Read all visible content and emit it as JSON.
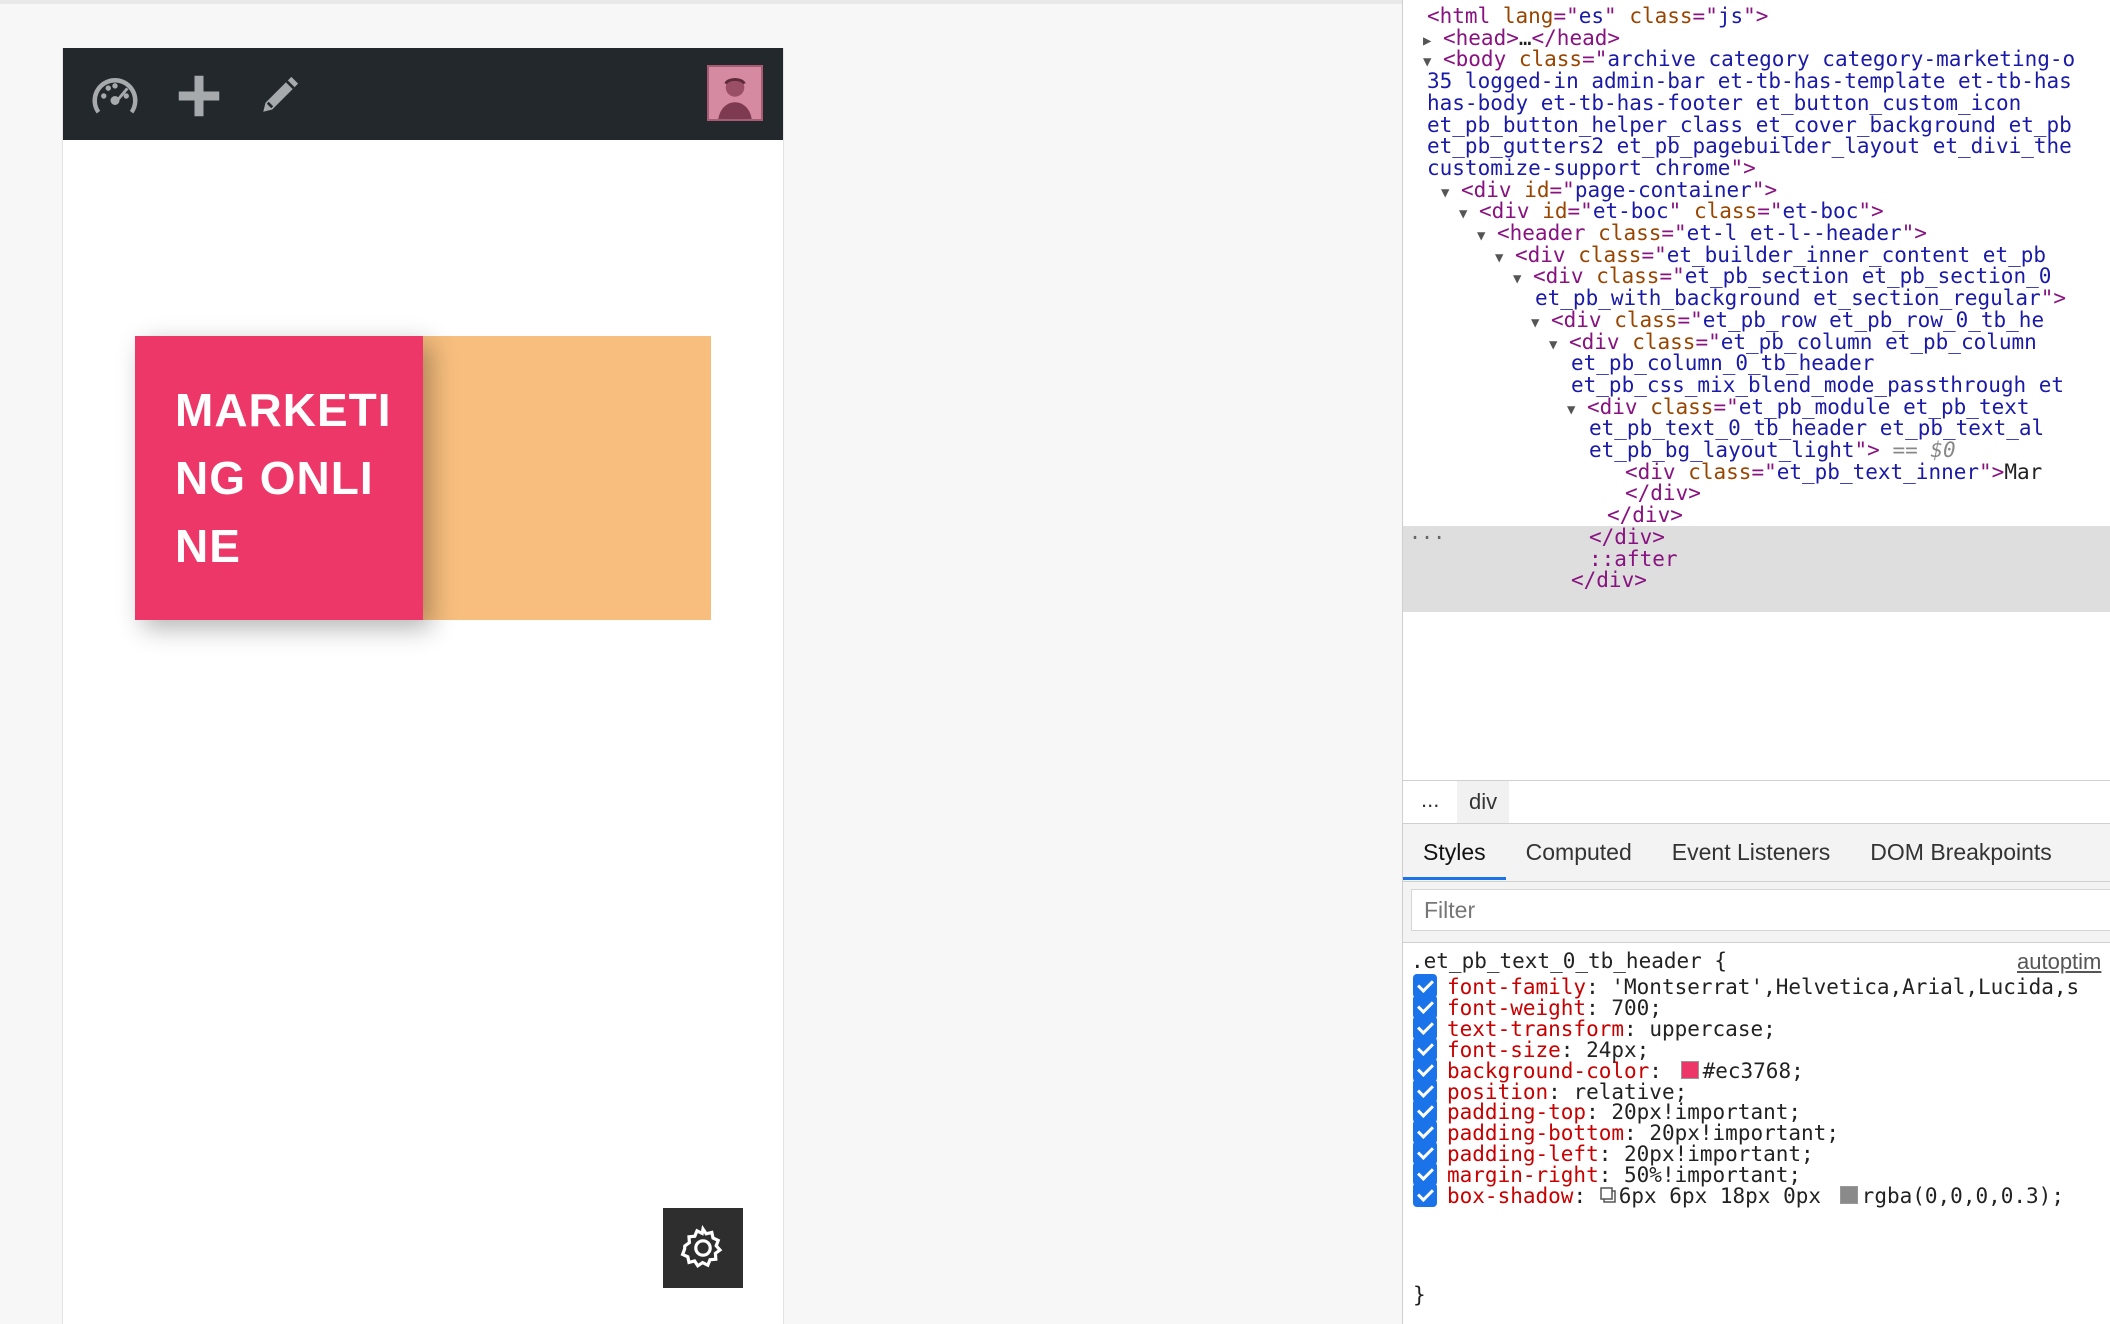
{
  "admin_bar": {
    "icons": [
      "dashboard-icon",
      "plus-icon",
      "pencil-icon"
    ],
    "avatar": "avatar"
  },
  "header": {
    "text": "Marketing Online",
    "pink_color": "#ec3768",
    "peach_color": "#f7be7e"
  },
  "elements": {
    "lines": [
      {
        "indent": 0,
        "tri": "",
        "parts": [
          [
            "tg",
            "<html "
          ],
          [
            "at",
            "lang"
          ],
          [
            "tg",
            "=\""
          ],
          [
            "av",
            "es"
          ],
          [
            "tg",
            "\" "
          ],
          [
            "at",
            "class"
          ],
          [
            "tg",
            "=\""
          ],
          [
            "av",
            "js"
          ],
          [
            "tg",
            "\">"
          ]
        ]
      },
      {
        "indent": 1,
        "tri": "▶",
        "parts": [
          [
            "tg",
            "<head>"
          ],
          [
            "tx",
            "…"
          ],
          [
            "tg",
            "</head>"
          ]
        ]
      },
      {
        "indent": 1,
        "tri": "▼",
        "parts": [
          [
            "tg",
            "<body "
          ],
          [
            "at",
            "class"
          ],
          [
            "tg",
            "=\""
          ],
          [
            "av",
            "archive category category-marketing-o"
          ]
        ]
      },
      {
        "indent": 0,
        "tri": "",
        "parts": [
          [
            "av",
            "35 logged-in admin-bar et-tb-has-template et-tb-has"
          ]
        ]
      },
      {
        "indent": 0,
        "tri": "",
        "parts": [
          [
            "av",
            "has-body et-tb-has-footer et_button_custom_icon"
          ]
        ]
      },
      {
        "indent": 0,
        "tri": "",
        "parts": [
          [
            "av",
            "et_pb_button_helper_class et_cover_background et_pb"
          ]
        ]
      },
      {
        "indent": 0,
        "tri": "",
        "parts": [
          [
            "av",
            "et_pb_gutters2 et_pb_pagebuilder_layout et_divi_the"
          ]
        ]
      },
      {
        "indent": 0,
        "tri": "",
        "parts": [
          [
            "av",
            "customize-support chrome"
          ],
          [
            "tg",
            "\">"
          ]
        ]
      },
      {
        "indent": 2,
        "tri": "▼",
        "parts": [
          [
            "tg",
            "<div "
          ],
          [
            "at",
            "id"
          ],
          [
            "tg",
            "=\""
          ],
          [
            "av",
            "page-container"
          ],
          [
            "tg",
            "\">"
          ]
        ]
      },
      {
        "indent": 3,
        "tri": "▼",
        "parts": [
          [
            "tg",
            "<div "
          ],
          [
            "at",
            "id"
          ],
          [
            "tg",
            "=\""
          ],
          [
            "av",
            "et-boc"
          ],
          [
            "tg",
            "\" "
          ],
          [
            "at",
            "class"
          ],
          [
            "tg",
            "=\""
          ],
          [
            "av",
            "et-boc"
          ],
          [
            "tg",
            "\">"
          ]
        ]
      },
      {
        "indent": 4,
        "tri": "▼",
        "parts": [
          [
            "tg",
            "<header "
          ],
          [
            "at",
            "class"
          ],
          [
            "tg",
            "=\""
          ],
          [
            "av",
            "et-l et-l--header"
          ],
          [
            "tg",
            "\">"
          ]
        ]
      },
      {
        "indent": 5,
        "tri": "▼",
        "parts": [
          [
            "tg",
            "<div "
          ],
          [
            "at",
            "class"
          ],
          [
            "tg",
            "=\""
          ],
          [
            "av",
            "et_builder_inner_content et_pb"
          ]
        ]
      },
      {
        "indent": 6,
        "tri": "▼",
        "parts": [
          [
            "tg",
            "<div "
          ],
          [
            "at",
            "class"
          ],
          [
            "tg",
            "=\""
          ],
          [
            "av",
            "et_pb_section et_pb_section_0"
          ]
        ]
      },
      {
        "indent": 6,
        "tri": "",
        "parts": [
          [
            "av",
            "et_pb_with_background et_section_regular"
          ],
          [
            "tg",
            "\">"
          ]
        ]
      },
      {
        "indent": 7,
        "tri": "▼",
        "parts": [
          [
            "tg",
            "<div "
          ],
          [
            "at",
            "class"
          ],
          [
            "tg",
            "=\""
          ],
          [
            "av",
            "et_pb_row et_pb_row_0_tb_he"
          ]
        ]
      },
      {
        "indent": 8,
        "tri": "▼",
        "parts": [
          [
            "tg",
            "<div "
          ],
          [
            "at",
            "class"
          ],
          [
            "tg",
            "=\""
          ],
          [
            "av",
            "et_pb_column et_pb_column"
          ]
        ]
      },
      {
        "indent": 8,
        "tri": "",
        "parts": [
          [
            "av",
            "et_pb_column_0_tb_header"
          ]
        ]
      },
      {
        "indent": 8,
        "tri": "",
        "parts": [
          [
            "av",
            "et_pb_css_mix_blend_mode_passthrough et"
          ]
        ]
      },
      {
        "indent": 9,
        "tri": "▼",
        "parts": [
          [
            "tg",
            "<div "
          ],
          [
            "at",
            "class"
          ],
          [
            "tg",
            "=\""
          ],
          [
            "av",
            "et_pb_module et_pb_text"
          ]
        ]
      },
      {
        "indent": 9,
        "tri": "",
        "parts": [
          [
            "av",
            "et_pb_text_0_tb_header  et_pb_text_al"
          ]
        ]
      },
      {
        "indent": 9,
        "tri": "",
        "parts": [
          [
            "av",
            "et_pb_bg_layout_light"
          ],
          [
            "tg",
            "\">"
          ],
          [
            "dim",
            " == $0"
          ]
        ]
      },
      {
        "indent": 11,
        "tri": "",
        "parts": [
          [
            "tg",
            "<div "
          ],
          [
            "at",
            "class"
          ],
          [
            "tg",
            "=\""
          ],
          [
            "av",
            "et_pb_text_inner"
          ],
          [
            "tg",
            "\">"
          ],
          [
            "tx",
            "Mar"
          ]
        ]
      },
      {
        "indent": 11,
        "tri": "",
        "parts": [
          [
            "tg",
            "</div>"
          ]
        ]
      },
      {
        "indent": 10,
        "tri": "",
        "parts": [
          [
            "tg",
            "</div>"
          ]
        ]
      },
      {
        "indent": 9,
        "tri": "",
        "parts": [
          [
            "tg",
            "</div>"
          ]
        ]
      },
      {
        "indent": 9,
        "tri": "",
        "parts": [
          [
            "tg",
            "::after"
          ]
        ]
      },
      {
        "indent": 8,
        "tri": "",
        "parts": [
          [
            "tg",
            "</div>"
          ]
        ]
      }
    ],
    "gutter": "..."
  },
  "breadcrumb": {
    "dots": "...",
    "current": "div"
  },
  "tabs": [
    "Styles",
    "Computed",
    "Event Listeners",
    "DOM Breakpoints"
  ],
  "filter": {
    "placeholder": "Filter",
    "value": ""
  },
  "styles": {
    "selector": ".et_pb_text_0_tb_header {",
    "source": "autoptim",
    "declarations": [
      {
        "prop": "font-family",
        "value": "'Montserrat',Helvetica,Arial,Lucida,s"
      },
      {
        "prop": "font-weight",
        "value": "700;"
      },
      {
        "prop": "text-transform",
        "value": "uppercase;"
      },
      {
        "prop": "font-size",
        "value": "24px;"
      },
      {
        "prop": "background-color",
        "value": "#ec3768;",
        "swatch": "#ec3768"
      },
      {
        "prop": "position",
        "value": "relative;"
      },
      {
        "prop": "padding-top",
        "value": "20px!important;"
      },
      {
        "prop": "padding-bottom",
        "value": "20px!important;"
      },
      {
        "prop": "padding-left",
        "value": "20px!important;"
      },
      {
        "prop": "margin-right",
        "value": "50%!important;"
      },
      {
        "prop": "box-shadow",
        "value": "6px 6px 18px 0px ",
        "value2": "rgba(0,0,0,0.3);",
        "swatch": "#8a8a8a",
        "shadow_icon": true
      }
    ],
    "close": "}"
  }
}
